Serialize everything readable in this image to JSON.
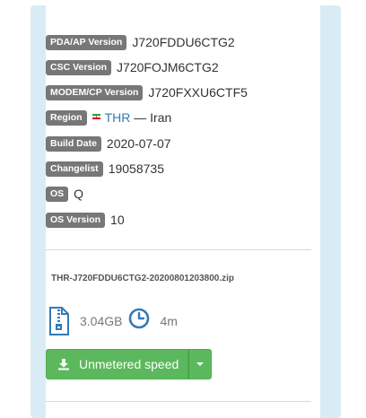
{
  "firmware": {
    "pda_label": "PDA/AP Version",
    "pda_value": "J720FDDU6CTG2",
    "csc_label": "CSC Version",
    "csc_value": "J720FOJM6CTG2",
    "modem_label": "MODEM/CP Version",
    "modem_value": "J720FXXU6CTF5",
    "region_label": "Region",
    "region_code": "THR",
    "region_sep": " — ",
    "region_name": "Iran",
    "build_date_label": "Build Date",
    "build_date_value": "2020-07-07",
    "changelist_label": "Changelist",
    "changelist_value": "19058735",
    "os_label": "OS",
    "os_value": "Q",
    "os_version_label": "OS Version",
    "os_version_value": "10"
  },
  "download": {
    "filename": "THR-J720FDDU6CTG2-20200801203800.zip",
    "size": "3.04GB",
    "time": "4m",
    "button_label": "Unmetered speed",
    "icons": [
      "zip-file-icon",
      "clock-icon",
      "download-icon",
      "caret-down-icon"
    ]
  },
  "colors": {
    "badge": "#777777",
    "link": "#337ab7",
    "button": "#5cb85c",
    "card_bg": "#d9ecf6",
    "flag": [
      "#239f40",
      "#ffffff",
      "#da0000"
    ]
  }
}
